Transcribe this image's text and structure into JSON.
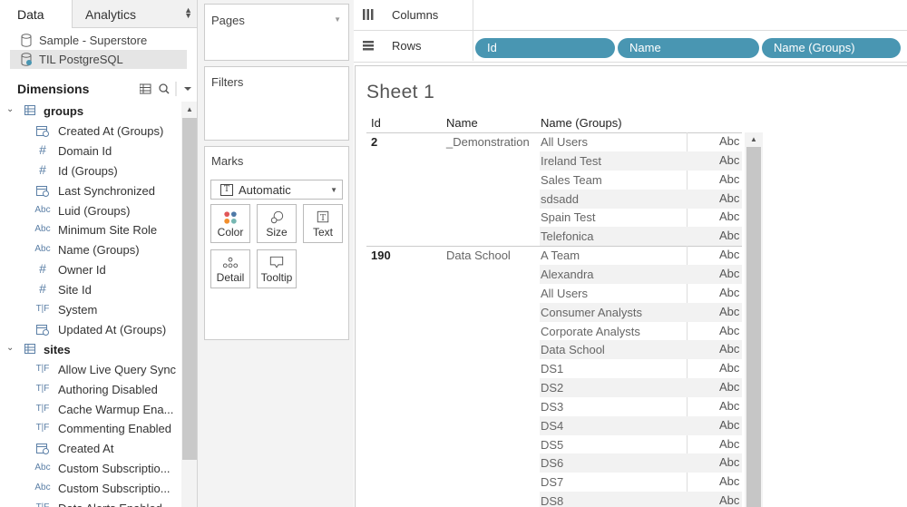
{
  "left_pane": {
    "tabs": {
      "data": "Data",
      "analytics": "Analytics"
    },
    "datasources": [
      "Sample - Superstore",
      "TIL PostgreSQL"
    ],
    "dimensions_title": "Dimensions",
    "fields": [
      {
        "label": "groups",
        "type": "table"
      },
      {
        "label": "Created At (Groups)",
        "type": "date",
        "icon": "⊞"
      },
      {
        "label": "Domain Id",
        "type": "num",
        "icon": "#"
      },
      {
        "label": "Id (Groups)",
        "type": "num",
        "icon": "#"
      },
      {
        "label": "Last Synchronized",
        "type": "date",
        "icon": "⊞"
      },
      {
        "label": "Luid (Groups)",
        "type": "str",
        "icon": "Abc"
      },
      {
        "label": "Minimum Site Role",
        "type": "str",
        "icon": "Abc"
      },
      {
        "label": "Name (Groups)",
        "type": "str",
        "icon": "Abc"
      },
      {
        "label": "Owner Id",
        "type": "num",
        "icon": "#"
      },
      {
        "label": "Site Id",
        "type": "num",
        "icon": "#"
      },
      {
        "label": "System",
        "type": "bool",
        "icon": "T|F"
      },
      {
        "label": "Updated At (Groups)",
        "type": "date",
        "icon": "⊞"
      },
      {
        "label": "sites",
        "type": "table"
      },
      {
        "label": "Allow Live Query Sync",
        "type": "bool",
        "icon": "T|F"
      },
      {
        "label": "Authoring Disabled",
        "type": "bool",
        "icon": "T|F"
      },
      {
        "label": "Cache Warmup Ena...",
        "type": "bool",
        "icon": "T|F"
      },
      {
        "label": "Commenting Enabled",
        "type": "bool",
        "icon": "T|F"
      },
      {
        "label": "Created At",
        "type": "date",
        "icon": "⊞"
      },
      {
        "label": "Custom Subscriptio...",
        "type": "str",
        "icon": "Abc"
      },
      {
        "label": "Custom Subscriptio...",
        "type": "str",
        "icon": "Abc"
      },
      {
        "label": "Data Alerts Enabled",
        "type": "bool",
        "icon": "T|F"
      }
    ]
  },
  "cards": {
    "pages": "Pages",
    "filters": "Filters",
    "marks": "Marks",
    "mark_type": "Automatic",
    "mark_buttons": [
      "Color",
      "Size",
      "Text",
      "Detail",
      "Tooltip"
    ],
    "text_glyph": "T"
  },
  "shelves": {
    "columns": "Columns",
    "rows": "Rows",
    "row_pills": [
      "Id",
      "Name",
      "Name (Groups)"
    ]
  },
  "sheet": {
    "title": "Sheet 1",
    "headers": [
      "Id",
      "Name",
      "Name (Groups)"
    ],
    "abc": "Abc",
    "groups": [
      {
        "id": "2",
        "name": "_Demonstration",
        "members": [
          "All Users",
          "Ireland Test",
          "Sales Team",
          "sdsadd",
          "Spain Test",
          "Telefonica"
        ]
      },
      {
        "id": "190",
        "name": "Data School",
        "members": [
          "A Team",
          "Alexandra",
          "All Users",
          "Consumer Analysts",
          "Corporate Analysts",
          "Data School",
          "DS1",
          "DS2",
          "DS3",
          "DS4",
          "DS5",
          "DS6",
          "DS7",
          "DS8"
        ]
      }
    ]
  },
  "colors": {
    "pill": "#4996b2",
    "icon_blue": "#5b7fa6"
  }
}
